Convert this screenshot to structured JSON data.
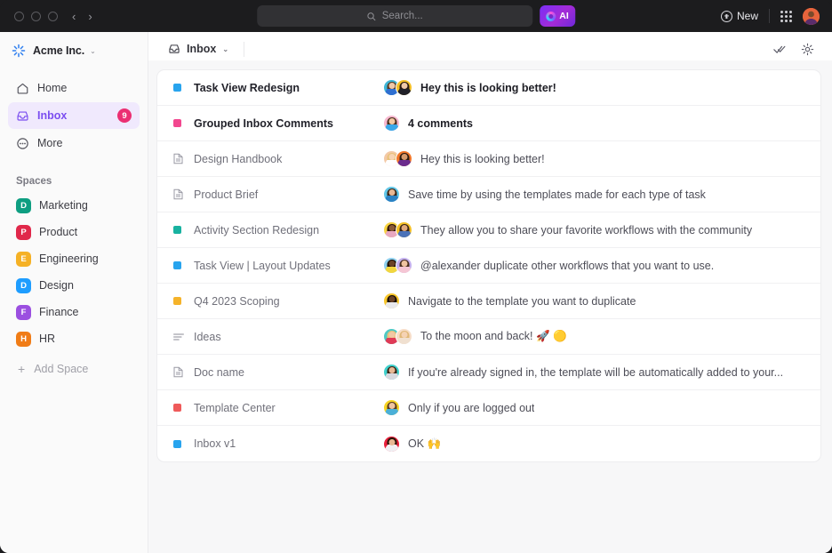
{
  "titlebar": {
    "window_controls": [
      "close",
      "minimize",
      "maximize"
    ],
    "nav_back": "‹",
    "nav_forward": "›",
    "search_placeholder": "Search...",
    "search_icon": "search-icon",
    "ai_label": "AI",
    "new_label": "New",
    "apps_icon": "grid-apps-icon",
    "avatar": "user-avatar"
  },
  "sidebar": {
    "workspace": {
      "name": "Acme Inc.",
      "caret": "⌄",
      "logo": "spark-logo-icon"
    },
    "nav": [
      {
        "label": "Home",
        "icon": "home-icon",
        "badge": "",
        "active": false
      },
      {
        "label": "Inbox",
        "icon": "inbox-icon",
        "badge": "9",
        "active": true
      },
      {
        "label": "More",
        "icon": "more-dots-icon",
        "badge": "",
        "active": false
      }
    ],
    "spaces_title": "Spaces",
    "spaces": [
      {
        "label": "Marketing",
        "initial": "D",
        "color": "#0e9e81"
      },
      {
        "label": "Product",
        "initial": "P",
        "color": "#e0284a"
      },
      {
        "label": "Engineering",
        "initial": "E",
        "color": "#f5b125"
      },
      {
        "label": "Design",
        "initial": "D",
        "color": "#1e9dff"
      },
      {
        "label": "Finance",
        "initial": "F",
        "color": "#9b4fe0"
      },
      {
        "label": "HR",
        "initial": "H",
        "color": "#f07c16"
      }
    ],
    "add_space": {
      "label": "Add Space",
      "icon": "plus-icon"
    }
  },
  "main": {
    "view_tab": {
      "label": "Inbox",
      "icon": "inbox-icon",
      "caret": "⌄"
    },
    "actions": [
      {
        "name": "mark-all-read-icon",
        "title": "Mark all read"
      },
      {
        "name": "settings-gear-icon",
        "title": "Settings"
      }
    ]
  },
  "inbox": {
    "rows": [
      {
        "title": "Task View Redesign",
        "icon": "status-square",
        "icon_color": "#28a4ee",
        "message": "Hey this is looking better!",
        "unread": true,
        "avatars": [
          {
            "bg": "#3fb6d6",
            "skin": "#f0c8a8",
            "hair": "#5a3a22",
            "shirt": "#2f6fd0"
          },
          {
            "bg": "#f5c026",
            "skin": "#f0c8a8",
            "hair": "#2a1a10",
            "shirt": "#202028"
          }
        ]
      },
      {
        "title": "Grouped Inbox Comments",
        "icon": "status-square",
        "icon_color": "#f2478f",
        "message": "4 comments",
        "unread": true,
        "avatars": [
          {
            "bg": "#f7b8cf",
            "skin": "#f2c8a4",
            "hair": "#4a2f1c",
            "shirt": "#3aa7e8"
          }
        ]
      },
      {
        "title": "Design Handbook",
        "icon": "doc-icon",
        "icon_color": "#9a9aa4",
        "message": "Hey this is looking better!",
        "unread": false,
        "avatars": [
          {
            "bg": "#f3c9a6",
            "skin": "#f7d4b4",
            "hair": "#e8c27a",
            "shirt": "#ffffff"
          },
          {
            "bg": "#f2772a",
            "skin": "#d79a6c",
            "hair": "#2a1a10",
            "shirt": "#6b2c8e"
          }
        ]
      },
      {
        "title": "Product Brief",
        "icon": "doc-icon",
        "icon_color": "#9a9aa4",
        "message": "Save time by using the templates made for each type of task",
        "unread": false,
        "avatars": [
          {
            "bg": "#62c7e8",
            "skin": "#e8b894",
            "hair": "#3a2414",
            "shirt": "#2b82c4"
          }
        ]
      },
      {
        "title": "Activity Section Redesign",
        "icon": "status-square",
        "icon_color": "#18b2a0",
        "message": "They allow you to share your favorite workflows with the community",
        "unread": false,
        "avatars": [
          {
            "bg": "#f7d23f",
            "skin": "#8a5a38",
            "hair": "#2a1208",
            "shirt": "#e8a8c0"
          },
          {
            "bg": "#f5c026",
            "skin": "#e0a87c",
            "hair": "#3a2414",
            "shirt": "#4a72b8"
          }
        ]
      },
      {
        "title": "Task View | Layout Updates",
        "icon": "status-square",
        "icon_color": "#28a4ee",
        "message": "@alexander duplicate other workflows that you want to use.",
        "unread": false,
        "avatars": [
          {
            "bg": "#8fd0ee",
            "skin": "#6b4328",
            "hair": "#1a0e06",
            "shirt": "#f2d63f"
          },
          {
            "bg": "#c4b0ee",
            "skin": "#f0c4a0",
            "hair": "#4a3020",
            "shirt": "#f5c6d4"
          }
        ]
      },
      {
        "title": "Q4 2023 Scoping",
        "icon": "status-square",
        "icon_color": "#f5b32a",
        "message": "Navigate to the template you want to duplicate",
        "unread": false,
        "avatars": [
          {
            "bg": "#f7c52a",
            "skin": "#6b4328",
            "hair": "#140a04",
            "shirt": "#e8e8ec"
          }
        ]
      },
      {
        "title": "Ideas",
        "icon": "list-lines-icon",
        "icon_color": "#9a9aa4",
        "message": "To the moon and back! 🚀 🟡",
        "unread": false,
        "avatars": [
          {
            "bg": "#4fc9c4",
            "skin": "#f2c8a4",
            "hair": "#e8c27a",
            "shirt": "#e03a56"
          },
          {
            "bg": "#f7ddc8",
            "skin": "#f5d2b4",
            "hair": "#e0b878",
            "shirt": "#f0e0d0"
          }
        ]
      },
      {
        "title": "Doc name",
        "icon": "doc-icon",
        "icon_color": "#9a9aa4",
        "message": "If you're already signed in, the template will be automatically added to your...",
        "unread": false,
        "avatars": [
          {
            "bg": "#3ed0cc",
            "skin": "#e8b894",
            "hair": "#3a2414",
            "shirt": "#d8d8de"
          }
        ]
      },
      {
        "title": "Template Center",
        "icon": "status-square",
        "icon_color": "#ef5a5a",
        "message": "Only if you are logged out",
        "unread": false,
        "avatars": [
          {
            "bg": "#f7d424",
            "skin": "#f0c4a0",
            "hair": "#5a3a20",
            "shirt": "#4ab0d8"
          }
        ]
      },
      {
        "title": "Inbox v1",
        "icon": "status-square",
        "icon_color": "#28a4ee",
        "message": "OK 🙌",
        "unread": false,
        "avatars": [
          {
            "bg": "#e8203c",
            "skin": "#e8b894",
            "hair": "#2a1408",
            "shirt": "#f0f0f4"
          }
        ]
      }
    ]
  }
}
